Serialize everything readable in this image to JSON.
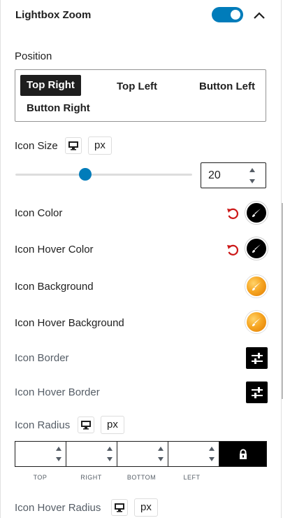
{
  "panel": {
    "title": "Lightbox Zoom",
    "toggle_on": true
  },
  "position": {
    "label": "Position",
    "options": [
      "Top Right",
      "Top Left",
      "Button Left",
      "Button Right"
    ],
    "selected": "Top Right"
  },
  "icon_size": {
    "label": "Icon Size",
    "unit": "px",
    "value": "20",
    "slider_level_percent": 40
  },
  "icon_color": {
    "label": "Icon Color",
    "swatch": "#000000"
  },
  "icon_hover_color": {
    "label": "Icon Hover Color",
    "swatch": "#000000"
  },
  "icon_background": {
    "label": "Icon Background"
  },
  "icon_hover_background": {
    "label": "Icon Hover Background"
  },
  "icon_border": {
    "label": "Icon Border"
  },
  "icon_hover_border": {
    "label": "Icon Hover Border"
  },
  "icon_radius": {
    "label": "Icon Radius",
    "unit": "px",
    "sides": [
      "TOP",
      "RIGHT",
      "BOTTOM",
      "LEFT"
    ],
    "values": [
      "",
      "",
      "",
      ""
    ]
  },
  "icon_hover_radius": {
    "label": "Icon Hover Radius",
    "unit": "px"
  },
  "colors": {
    "accent": "#007cba",
    "reset": "#cc1818",
    "dark": "#1e1e1e"
  },
  "icons": {
    "collapse": "chevron-up-icon",
    "device": "desktop-icon",
    "reset": "reset-icon",
    "picker": "paintbrush-icon",
    "border": "sliders-icon",
    "lock": "lock-icon"
  }
}
